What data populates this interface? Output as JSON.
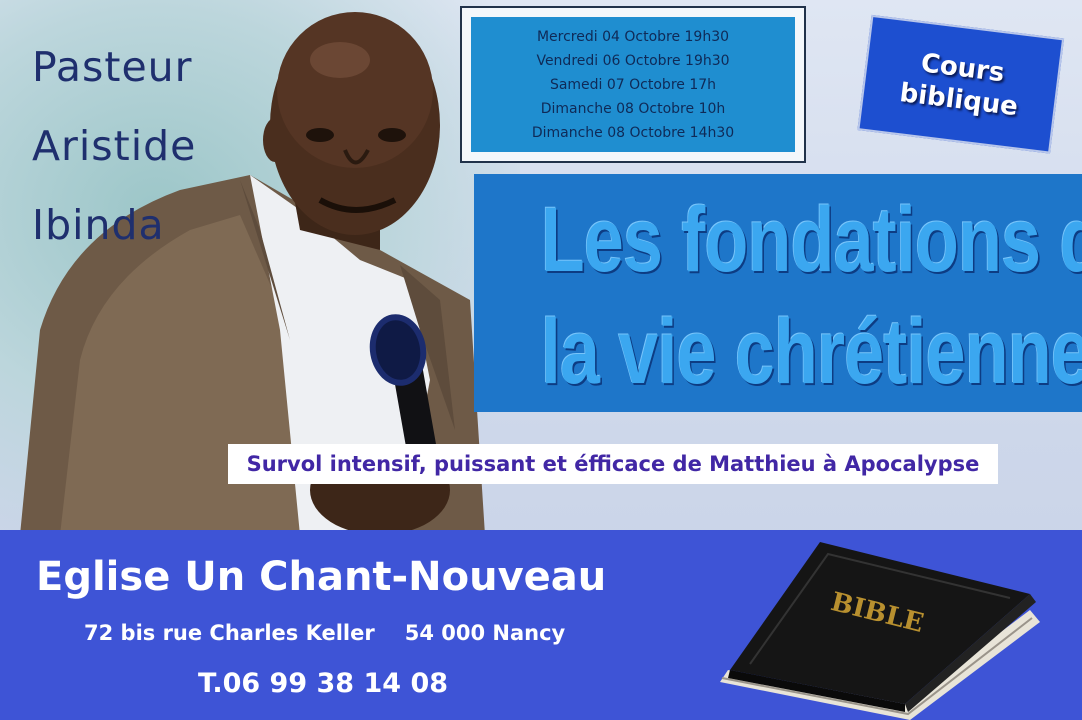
{
  "pastor": {
    "line1": "Pasteur",
    "line2": "Aristide",
    "line3": "Ibinda"
  },
  "schedule": [
    "Mercredi 04 Octobre 19h30",
    "Vendredi 06 Octobre 19h30",
    "Samedi 07 Octobre 17h",
    "Dimanche 08 Octobre 10h",
    "Dimanche 08 Octobre 14h30"
  ],
  "badge": {
    "line1": "Cours",
    "line2": "biblique"
  },
  "title": {
    "line1": "Les fondations de",
    "line2": "la vie chrétienne"
  },
  "subtitle": "Survol intensif, puissant et éfficace de Matthieu à Apocalypse",
  "church": {
    "name": "Eglise Un Chant-Nouveau",
    "street": "72 bis rue Charles Keller",
    "city": "54 000 Nancy",
    "phone": "T.06 99 38 14 08"
  },
  "bible_label": "BIBLE",
  "colors": {
    "title_band": "#1e76c9",
    "bottom_band": "#3e54d6",
    "badge": "#1d4fd0",
    "schedule_bg": "#1f8ed0"
  }
}
